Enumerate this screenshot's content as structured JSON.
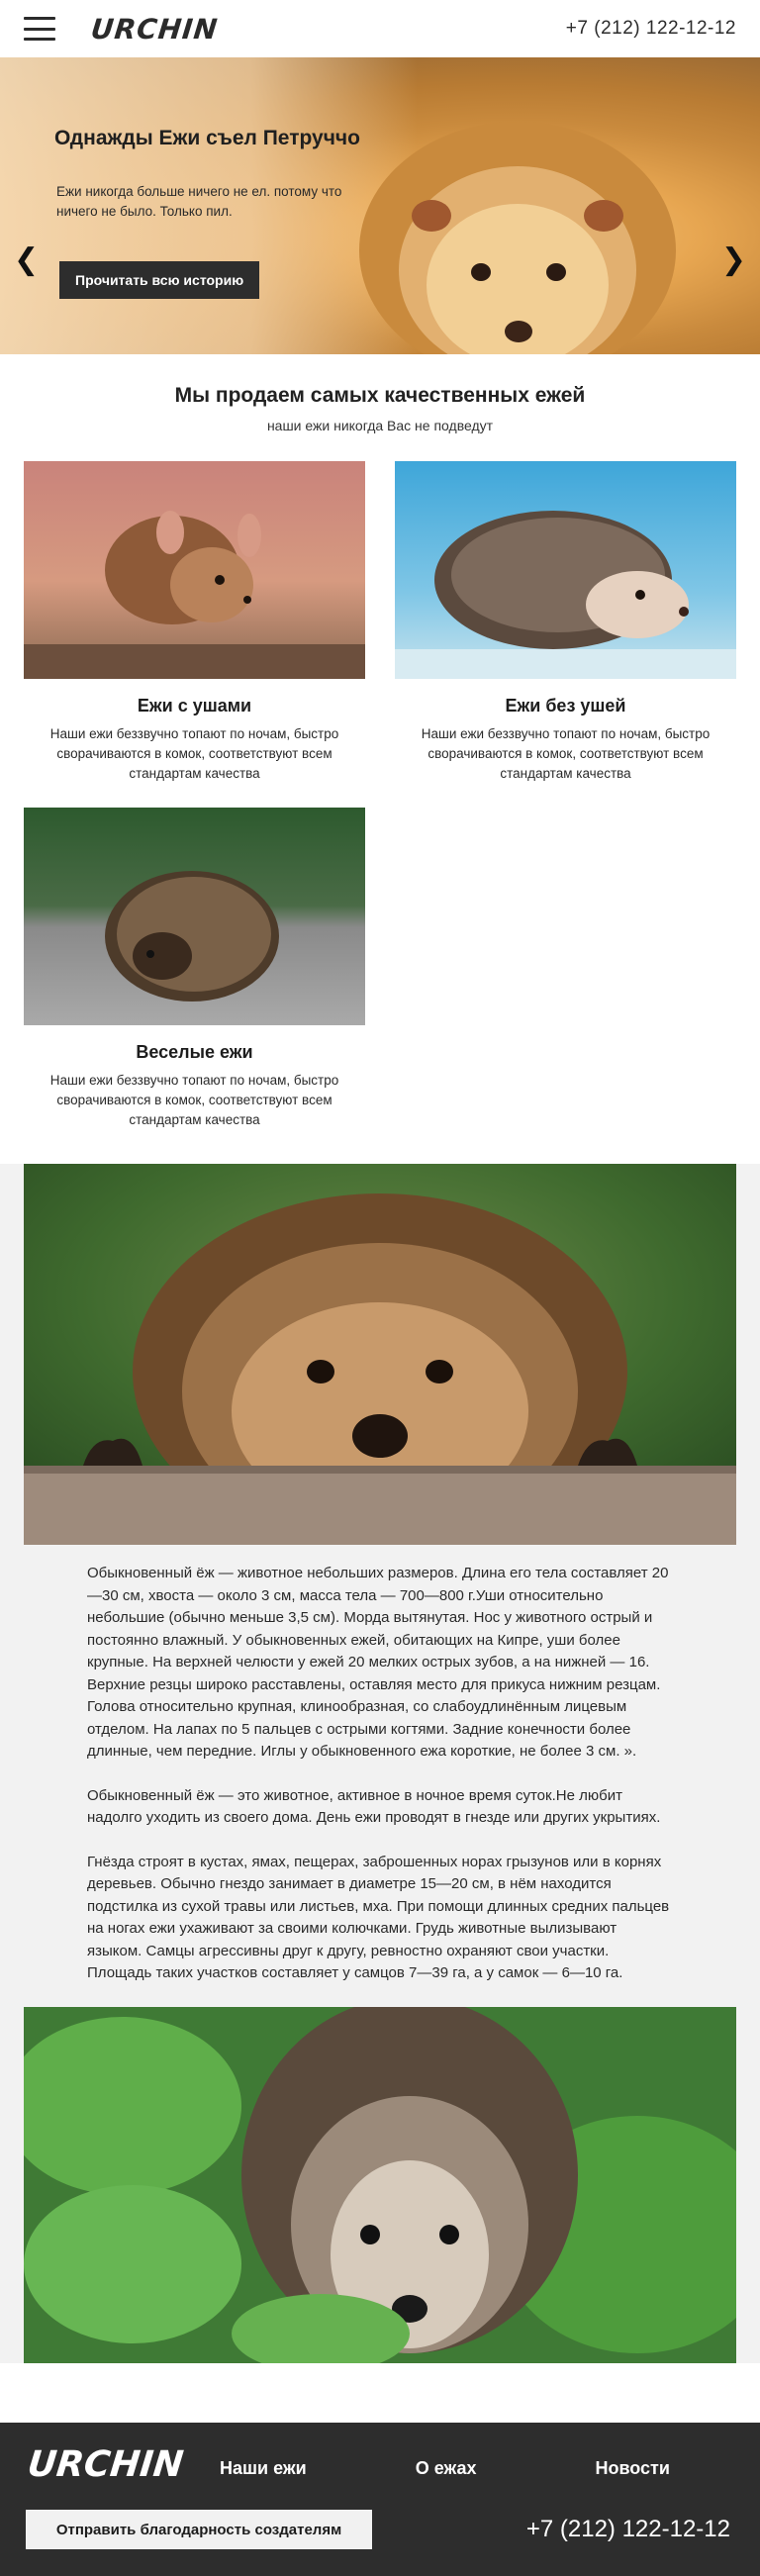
{
  "header": {
    "logo": "URCHIN",
    "phone": "+7 (212) 122-12-12",
    "menu_icon": "hamburger-menu-icon"
  },
  "hero": {
    "title": "Однажды Ежи съел Петруччо",
    "text": "Ежи никогда больше ничего не ел. потому что ничего не было. Только пил.",
    "button": "Прочитать всю историю",
    "prev_icon": "chevron-left-icon",
    "next_icon": "chevron-right-icon"
  },
  "products": {
    "title": "Мы продаем самых качественных ежей",
    "subtitle": "наши ежи никогда Вас не подведут",
    "items": [
      {
        "title": "Ежи с ушами",
        "text": "Наши ежи беззвучно топают по ночам, быстро сворачиваются в комок, соответствуют всем стандартам качества"
      },
      {
        "title": "Ежи без ушей",
        "text": "Наши ежи беззвучно топают по ночам, быстро сворачиваются в комок, соответствуют всем стандартам качества"
      },
      {
        "title": "Веселые ежи",
        "text": "Наши ежи беззвучно топают по ночам, быстро сворачиваются в комок, соответствуют всем стандартам качества"
      }
    ]
  },
  "article": {
    "paragraphs": [
      "Обыкновенный ёж — животное небольших размеров. Длина его тела составляет 20—30 см, хвоста — около 3 см, масса тела — 700—800 г.Уши относительно небольшие (обычно меньше 3,5 см). Морда вытянутая. Нос у животного острый и постоянно влажный. У обыкновенных ежей, обитающих на Кипре, уши более крупные. На верхней челюсти у ежей 20 мелких острых зубов, а на нижней — 16. Верхние резцы широко расставлены, оставляя место для прикуса нижним резцам. Голова относительно крупная, клинообразная, со слабоудлинённым лицевым отделом. На лапах по 5 пальцев с острыми когтями. Задние конечности более длинные, чем передние. Иглы у обыкновенного ежа короткие, не более 3 см. ».",
      "Обыкновенный ёж — это животное, активное в ночное время суток.Не любит надолго уходить из своего дома. День ежи проводят в гнезде или других укрытиях.",
      "Гнёзда строят в кустах, ямах, пещерах, заброшенных норах грызунов или в корнях деревьев. Обычно гнездо занимает в диаметре 15—20 см, в нём находится подстилка из сухой травы или листьев, мха. При помощи длинных средних пальцев на ногах ежи ухаживают за своими колючками. Грудь животные вылизывают языком. Самцы агрессивны друг к другу, ревностно охраняют свои участки. Площадь таких участков составляет у самцов 7—39 га, а у самок — 6—10 га."
    ]
  },
  "footer": {
    "logo": "URCHIN",
    "nav": [
      "Наши ежи",
      "О ежах",
      "Новости"
    ],
    "button": "Отправить благодарность создателям",
    "phone": "+7 (212) 122-12-12"
  },
  "colors": {
    "dark": "#2d2d2d",
    "article_bg": "#f2f2f2",
    "hero_warm": "#e7a651"
  }
}
